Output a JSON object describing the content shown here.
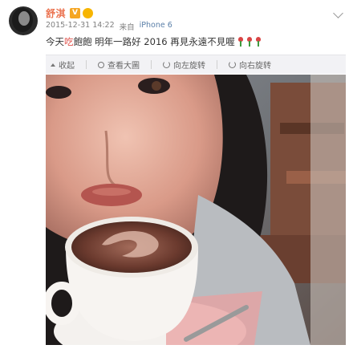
{
  "post": {
    "username": "舒淇",
    "vip_badge": "V",
    "timestamp": "2015-12-31 14:22",
    "source_prefix": "来自",
    "device": "iPhone 6",
    "content_before": "今天",
    "content_highlight": "吃",
    "content_after": "飽飽 明年一路好 2016 再見永遠不見喔"
  },
  "toolbar": {
    "collapse_label": "收起",
    "view_large_label": "查看大圖",
    "rotate_left_label": "向左旋转",
    "rotate_right_label": "向右旋转"
  },
  "colors": {
    "username": "#eb7350",
    "highlight": "#e0514a",
    "link": "#5a7fa8",
    "toolbar_bg": "#f2f2f5"
  }
}
